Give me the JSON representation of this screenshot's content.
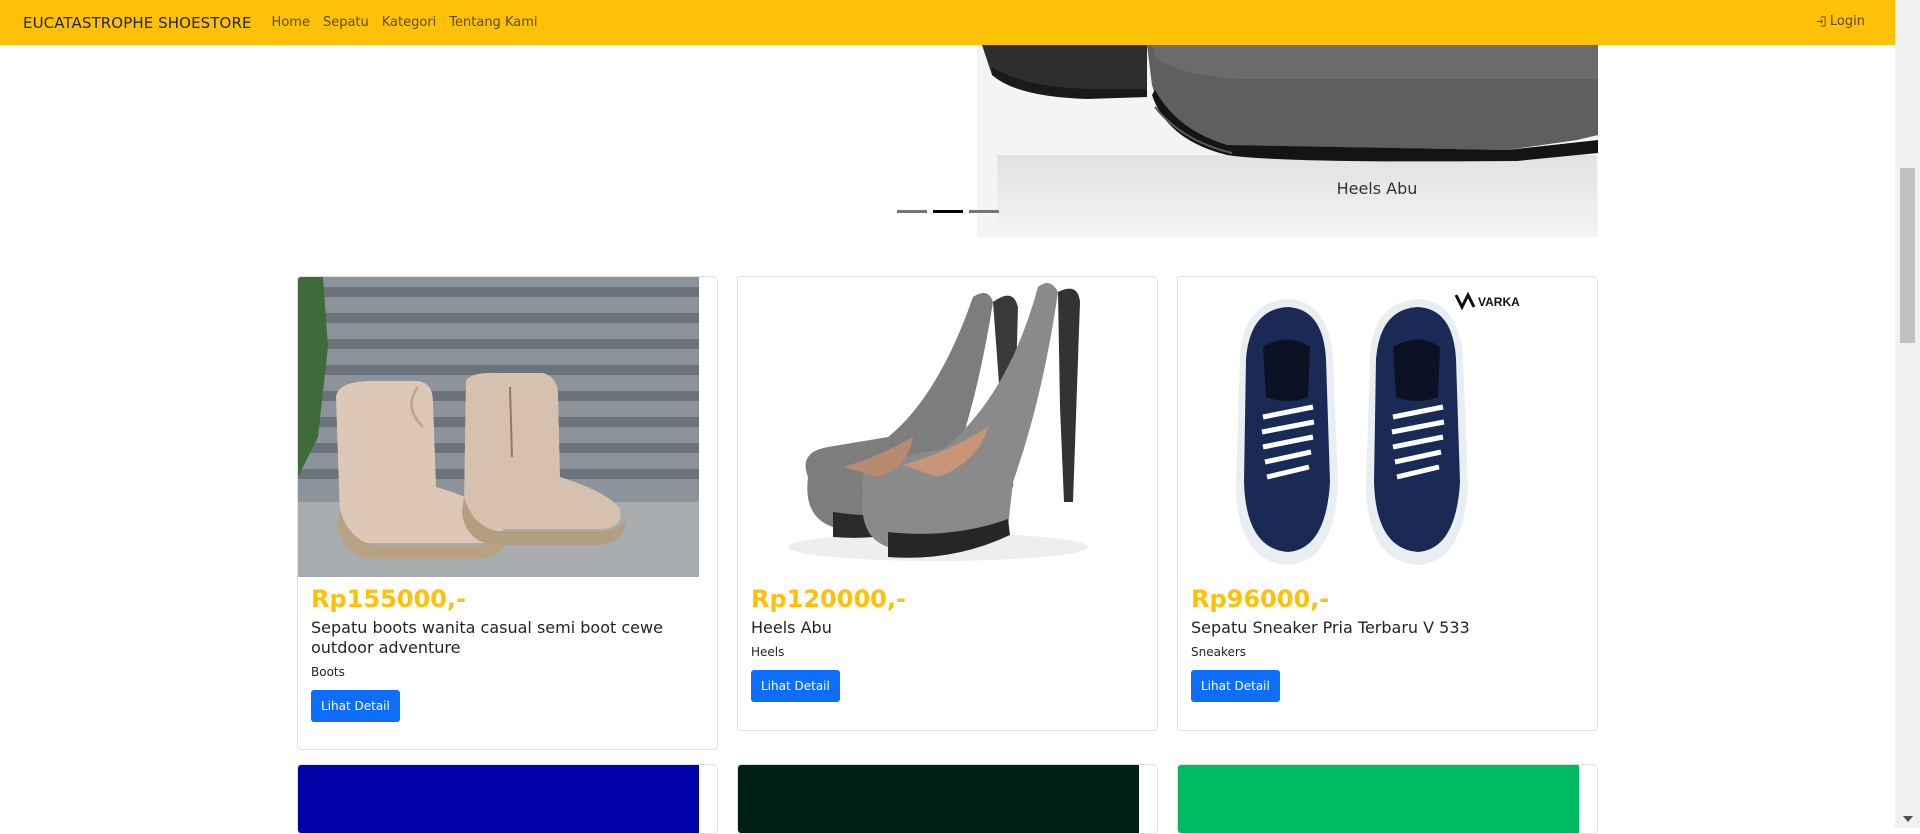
{
  "navbar": {
    "brand": "EUCATASTROPHE SHOESTORE",
    "links": [
      "Home",
      "Sepatu",
      "Kategori",
      "Tentang Kami"
    ],
    "login": "Login",
    "color": "#ffc107"
  },
  "carousel": {
    "caption": "Heels Abu",
    "slide_count": 3,
    "active_index": 1
  },
  "products": [
    {
      "price": "Rp155000,-",
      "title": "Sepatu boots wanita casual semi boot cewe outdoor adventure",
      "category": "Boots",
      "button": "Lihat Detail"
    },
    {
      "price": "Rp120000,-",
      "title": "Heels Abu",
      "category": "Heels",
      "button": "Lihat Detail"
    },
    {
      "price": "Rp96000,-",
      "title": "Sepatu Sneaker Pria Terbaru V 533",
      "category": "Sneakers",
      "button": "Lihat Detail",
      "brand_logo": "VARKA"
    }
  ],
  "colors": {
    "price": "#ffc107",
    "button": "#0d6efd",
    "next_row_images": [
      "#0101a8",
      "#012015",
      "#00b963"
    ]
  }
}
